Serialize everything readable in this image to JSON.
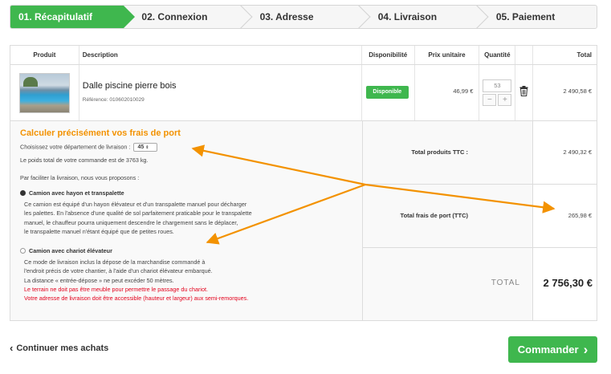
{
  "steps": [
    {
      "label": "01. Récapitulatif",
      "active": true
    },
    {
      "label": "02. Connexion"
    },
    {
      "label": "03. Adresse"
    },
    {
      "label": "04. Livraison"
    },
    {
      "label": "05. Paiement"
    }
  ],
  "table": {
    "headers": [
      "Produit",
      "Description",
      "Disponibilité",
      "Prix unitaire",
      "Quantité",
      "",
      "Total"
    ],
    "product": {
      "name": "Dalle piscine pierre bois",
      "reference": "Référence: 010602010029",
      "availability": "Disponible",
      "unit_price": "46,99 €",
      "quantity": "53",
      "minus": "−",
      "plus": "+",
      "total": "2 490,58 €"
    }
  },
  "shipping": {
    "title": "Calculer précisément vos frais de port",
    "department_label": "Choisissez votre département de livraison :",
    "department_value": "45",
    "weight_text": "Le poids total de votre commande est de 3763 kg.",
    "intro": "Par faciliter la livraison, nous vous proposons :",
    "option1": {
      "title": "Camion avec hayon et transpalette",
      "lines": [
        "Ce camion est équipé d'un hayon élévateur et d'un transpalette manuel pour décharger",
        "les palettes. En l'absence d'une qualité de sol parfaitement praticable pour le transpalette",
        "manuel, le chauffeur pourra uniquement descendre le chargement sans le déplacer,",
        "le transpalette manuel n'étant équipé que de petites roues."
      ]
    },
    "option2": {
      "title": "Camion avec chariot élévateur",
      "lines": [
        "Ce mode de livraison inclus la dépose de la marchandise commandé à",
        "l'endroit précis de votre chantier, à l'aide d'un chariot élévateur embarqué.",
        "La distance « entrée-dépose » ne peut excéder 50 mètres."
      ],
      "warning1": "Le terrain ne doit pas être meuble pour permettre le passage du chariot.",
      "warning2": "Votre adresse de livraison doit être accessible (hauteur et largeur) aux semi-remorques."
    }
  },
  "summary": {
    "products_label": "Total produits TTC :",
    "products_value": "2 490,32 €",
    "shipping_label": "Total frais de port (TTC)",
    "shipping_value": "265,98 €",
    "total_label": "TOTAL",
    "total_value": "2 756,30 €"
  },
  "footer": {
    "continue_label": "Continuer mes achats",
    "order_label": "Commander"
  },
  "colors": {
    "green": "#3fb74e",
    "orange_arrow": "#f39200",
    "warning_red": "#e3001b"
  }
}
